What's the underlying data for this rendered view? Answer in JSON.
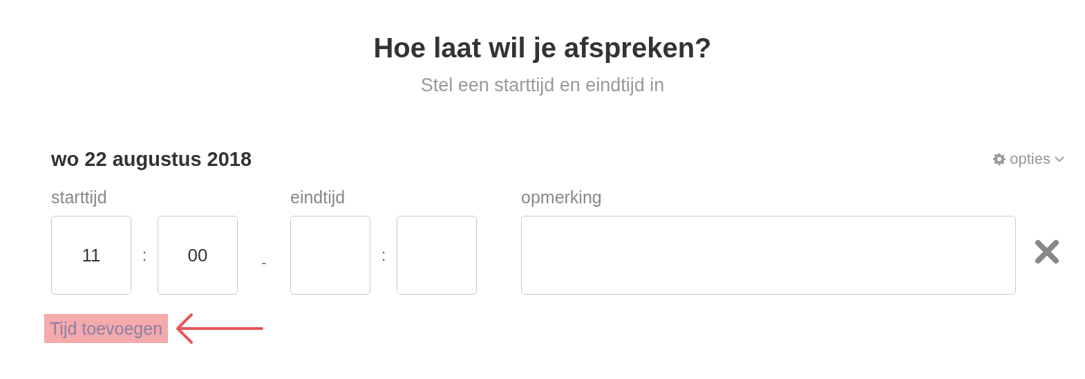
{
  "title": "Hoe laat wil je afspreken?",
  "subtitle": "Stel een starttijd en eindtijd in",
  "day": {
    "date": "wo 22 augustus 2018",
    "options_label": "opties"
  },
  "start": {
    "label": "starttijd",
    "hour": "11",
    "separator": ":",
    "minute": "00"
  },
  "range_separator": "-",
  "end": {
    "label": "eindtijd",
    "separator": ":"
  },
  "note": {
    "label": "opmerking"
  },
  "add_link": {
    "label": "Tijd toevoegen",
    "highlighted": true
  }
}
